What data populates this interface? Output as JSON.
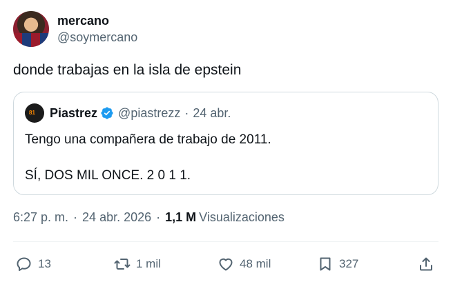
{
  "author": {
    "display_name": "mercano",
    "handle": "@soymercano"
  },
  "tweet": {
    "text": "donde trabajas en la isla de epstein"
  },
  "quote": {
    "display_name": "Piastrez",
    "handle": "@piastrezz",
    "separator": "·",
    "date": "24 abr.",
    "line1": "Tengo una compañera de trabajo de 2011.",
    "line2": "SÍ, DOS MIL ONCE.   2 0 1 1."
  },
  "meta": {
    "time": "6:27 p. m.",
    "dot1": "·",
    "date": "24 abr. 2026",
    "dot2": "·",
    "views_count": "1,1 M",
    "views_label": "Visualizaciones"
  },
  "actions": {
    "replies": "13",
    "reposts": "1 mil",
    "likes": "48 mil",
    "bookmarks": "327"
  },
  "colors": {
    "text": "#0f1419",
    "secondary": "#536471",
    "border": "#cfd9de",
    "verified": "#1d9bf0"
  }
}
